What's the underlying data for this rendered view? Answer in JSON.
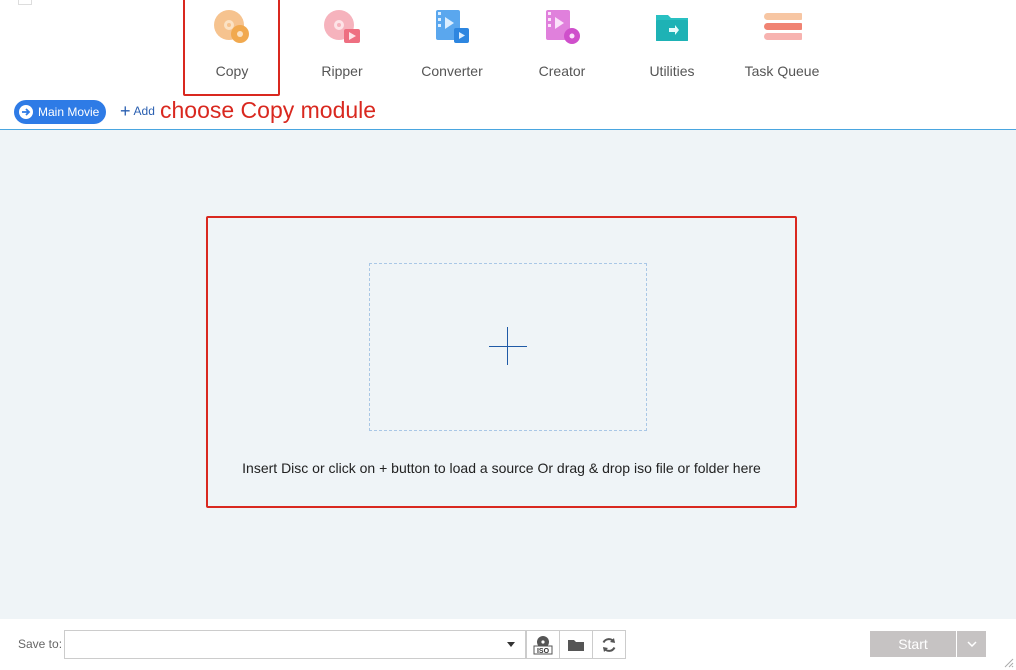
{
  "modules": [
    {
      "key": "copy",
      "label": "Copy",
      "icon": "copy-disc-icon"
    },
    {
      "key": "ripper",
      "label": "Ripper",
      "icon": "ripper-disc-icon"
    },
    {
      "key": "converter",
      "label": "Converter",
      "icon": "converter-film-icon"
    },
    {
      "key": "creator",
      "label": "Creator",
      "icon": "creator-film-icon"
    },
    {
      "key": "utilities",
      "label": "Utilities",
      "icon": "utilities-folder-icon"
    },
    {
      "key": "taskqueue",
      "label": "Task Queue",
      "icon": "task-queue-list-icon"
    }
  ],
  "toolbar": {
    "main_movie": "Main Movie",
    "add": "Add"
  },
  "annotation": "choose Copy module",
  "dropzone": {
    "hint": "Insert Disc or click on + button to load a source Or drag & drop iso file or folder here"
  },
  "footer": {
    "save_label": "Save to:",
    "save_value": "",
    "start": "Start"
  },
  "colors": {
    "accent": "#2e7be6",
    "highlight": "#d9281f",
    "content_bg": "#eff4f7",
    "start_disabled": "#c6c3c3"
  }
}
